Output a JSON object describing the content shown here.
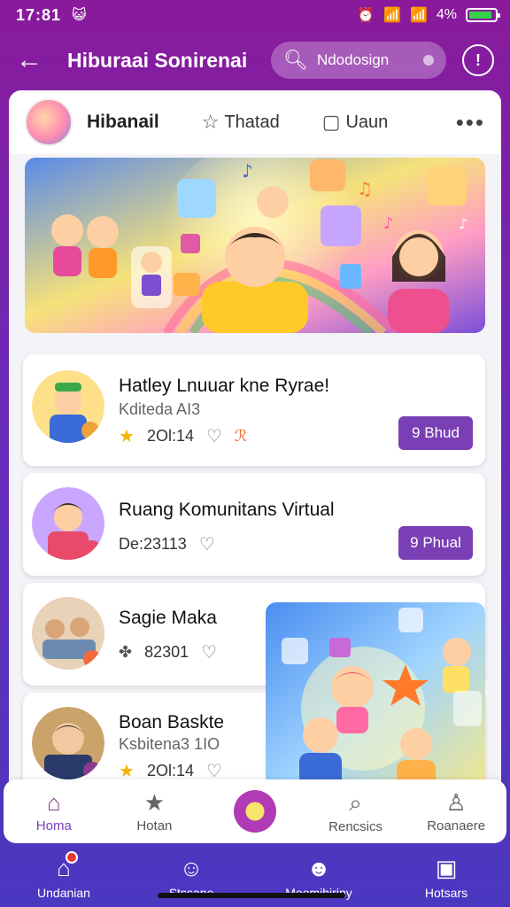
{
  "status_bar": {
    "time": "17:81",
    "battery": "4%",
    "battery_level": 0.9
  },
  "app_bar": {
    "title": "Hiburaai Sonirenai",
    "search_text": "Ndodosign"
  },
  "profile": {
    "name": "Hibanail",
    "tab1": "Thatad",
    "tab2": "Uaun"
  },
  "feed": [
    {
      "title": "Hatley Lnuuar kne Ryrae!",
      "subtitle": "Kditeda AI3",
      "meta": "2Ol:14",
      "action": "9 Bhud"
    },
    {
      "title": "Ruang Komunitans Virtual",
      "meta": "De:23113",
      "action": "9 Phual"
    },
    {
      "title": "Sagie Maka",
      "meta": "82301",
      "action": ""
    },
    {
      "title": "Boan Baskte",
      "subtitle": "Ksbitena3 1IO",
      "meta": "2Ol:14",
      "action": ""
    }
  ],
  "bottom_nav": [
    {
      "label": "Homa",
      "icon": "home-icon"
    },
    {
      "label": "Hotan",
      "icon": "star-icon"
    },
    {
      "label": "",
      "icon": "center-icon"
    },
    {
      "label": "Rencsics",
      "icon": "search-icon"
    },
    {
      "label": "Roanaere",
      "icon": "profile-icon"
    }
  ],
  "dock": [
    {
      "label": "Undanian",
      "icon": "home-icon"
    },
    {
      "label": "Stssane",
      "icon": "person-icon"
    },
    {
      "label": "Moomihiriny",
      "icon": "smiley-icon"
    },
    {
      "label": "Hotsars",
      "icon": "chat-icon"
    }
  ],
  "colors": {
    "accent": "#7a3fb5",
    "bg_top": "#8a1a9b",
    "bg_bottom": "#4b38c0"
  }
}
